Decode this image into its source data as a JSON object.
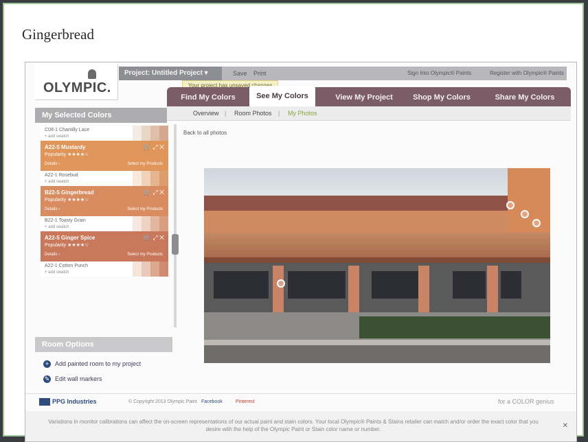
{
  "page": {
    "title": "Gingerbread"
  },
  "app": {
    "logo": "OLYMPIC.",
    "project_tab": "Project: Untitled Project ▾",
    "save": "Save",
    "print": "Print",
    "signin": "Sign Into Olympic® Paints",
    "register": "Register with Olympic® Paints",
    "notice": "Your project has unsaved changes"
  },
  "nav": {
    "tabs": [
      "Find My Colors",
      "See My Colors",
      "View My Project",
      "Shop My Colors",
      "Share My Colors"
    ],
    "active": "See My Colors",
    "subtabs": [
      "Overview",
      "Room Photos",
      "My Photos"
    ],
    "sep": "|"
  },
  "sidebar": {
    "title": "My Selected Colors",
    "back": "Back to all photos",
    "rows": [
      {
        "type": "row",
        "name": "C08-1 Chantilly Lace",
        "sub": "+ add swatch",
        "chips": [
          "#f3ece4",
          "#ead6c6",
          "#dfbfa9",
          "#d4a88f"
        ]
      },
      {
        "type": "card",
        "name": "A22-5 Mustardy",
        "pop": "Popularity ★★★★☆",
        "l1": "Details ›",
        "l2": "Select my Products",
        "color": "#e0955a"
      },
      {
        "type": "row",
        "name": "A22-1 Rosebud",
        "sub": "+ add swatch",
        "chips": [
          "#f7e9dc",
          "#f0d2b6",
          "#e6b58f",
          "#dc9c6c"
        ]
      },
      {
        "type": "card",
        "name": "B22-5 Gingerbread",
        "pop": "Popularity ★★★★☆",
        "l1": "Details ›",
        "l2": "Select my Products",
        "color": "#d88c60"
      },
      {
        "type": "row",
        "name": "B22-1 Toasty Grain",
        "sub": "+ add swatch",
        "chips": [
          "#f6e8df",
          "#eed2c2",
          "#e3b79f",
          "#d99d80"
        ]
      },
      {
        "type": "card",
        "name": "A22-5 Ginger Spice",
        "pop": "Popularity ★★★★☆",
        "l1": "Details ›",
        "l2": "Select my Products",
        "color": "#c9785c"
      },
      {
        "type": "row",
        "name": "A22-1 Cotton Punch",
        "sub": "+ add swatch",
        "chips": [
          "#f5e4dc",
          "#ebc9b9",
          "#dea890",
          "#cf8b70"
        ]
      }
    ],
    "card_icons": "🛒 ⤢ ✕"
  },
  "room_options": {
    "title": "Room Options",
    "items": [
      "Add painted room to my project",
      "Edit wall markers"
    ]
  },
  "footer": {
    "ppg": "PPG Industries",
    "copyright": "© Copyright 2013 Olympic Paint",
    "facebook": "Facebook",
    "pinterest": "Pinterest",
    "tagline": "for a COLOR genius",
    "disclaimer": "Variations in monitor calibrations can affect the on-screen representations of our actual paint and stain colors. Your local Olympic® Paints & Stains retailer can match and/or order the exact color that you desire with the help of the Olympic Paint or Stain color name or number.",
    "close": "✕"
  },
  "colors": {
    "nav_bg": "#7b5d68",
    "accent_blue": "#2e4c7e",
    "pinterest_red": "#c0392b"
  }
}
